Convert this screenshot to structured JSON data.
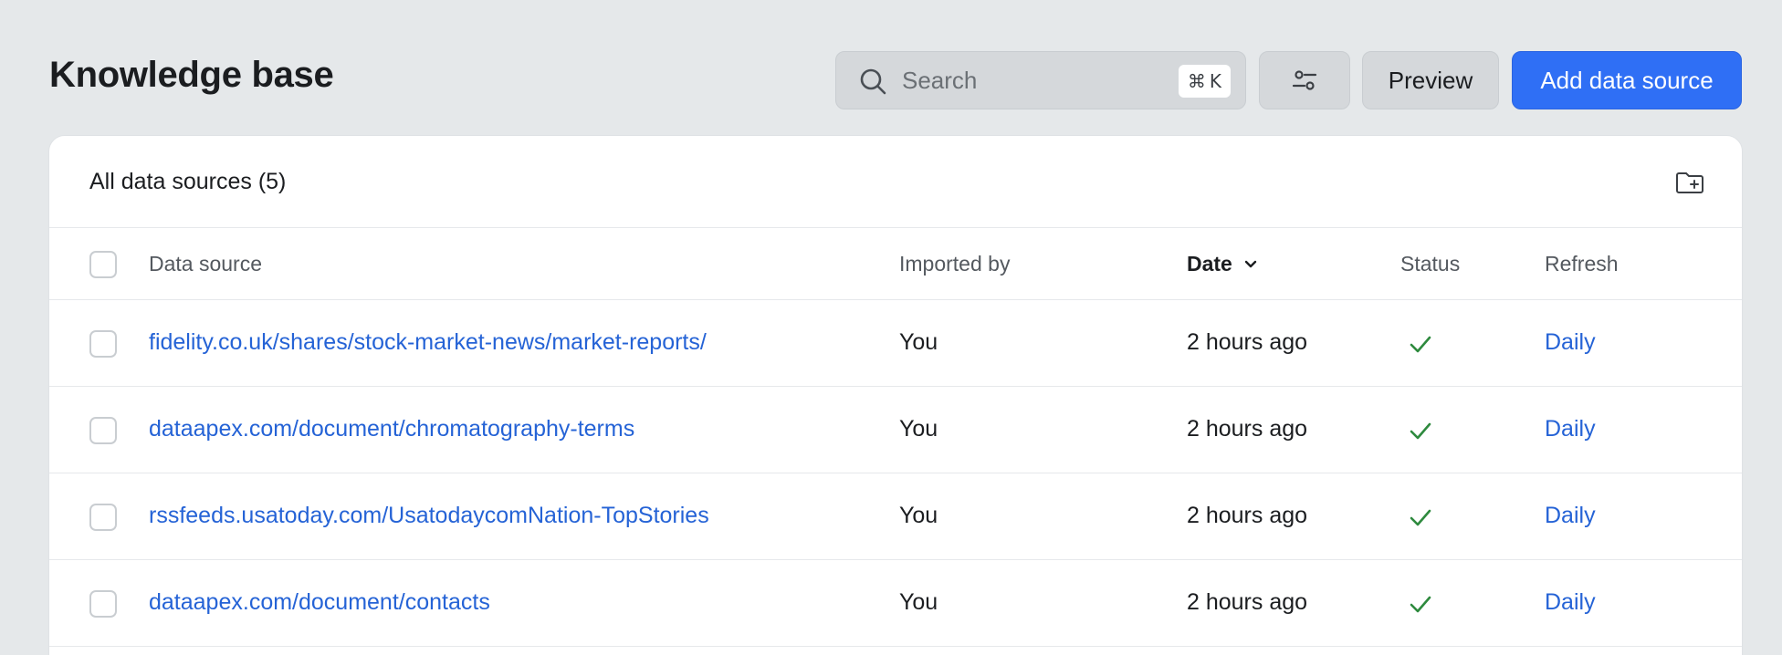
{
  "page": {
    "title": "Knowledge base"
  },
  "toolbar": {
    "search_placeholder": "Search",
    "shortcut_symbol": "⌘",
    "shortcut_key": "K",
    "filter_icon": "sliders-icon",
    "preview_label": "Preview",
    "add_label": "Add data source"
  },
  "card": {
    "title": "All data sources (5)",
    "folder_icon": "folder-add-icon"
  },
  "table": {
    "columns": {
      "source": "Data source",
      "importer": "Imported by",
      "date": "Date",
      "status": "Status",
      "refresh": "Refresh"
    },
    "rows": [
      {
        "source": "fidelity.co.uk/shares/stock-market-news/market-reports/",
        "importer": "You",
        "date": "2 hours ago",
        "status": "check-icon",
        "refresh": "Daily"
      },
      {
        "source": "dataapex.com/document/chromatography-terms",
        "importer": "You",
        "date": "2 hours ago",
        "status": "check-icon",
        "refresh": "Daily"
      },
      {
        "source": "rssfeeds.usatoday.com/UsatodaycomNation-TopStories",
        "importer": "You",
        "date": "2 hours ago",
        "status": "check-icon",
        "refresh": "Daily"
      },
      {
        "source": "dataapex.com/document/contacts",
        "importer": "You",
        "date": "2 hours ago",
        "status": "check-icon",
        "refresh": "Daily"
      }
    ]
  },
  "colors": {
    "background": "#e5e8ea",
    "primary": "#2f6ff5",
    "link": "#2563d6",
    "success": "#2e8a3e"
  }
}
